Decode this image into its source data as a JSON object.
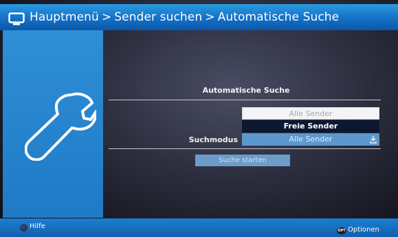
{
  "header": {
    "breadcrumb": [
      "Hauptmenü",
      "Sender suchen",
      "Automatische Suche"
    ],
    "separator": ">",
    "icon": "tv-icon"
  },
  "sidepanel": {
    "icon": "wrench-icon"
  },
  "main": {
    "heading": "Automatische Suche",
    "field_label": "Suchmodus",
    "dropdown": {
      "options": [
        "Alle Sender",
        "Freie Sender"
      ],
      "highlighted": "Freie Sender",
      "current_value": "Alle Sender",
      "icon": "download-arrow-icon"
    },
    "start_button": "Suche starten"
  },
  "footer": {
    "help_label": "Hilfe",
    "options_badge": "OPT",
    "options_label": "Optionen"
  },
  "colors": {
    "title_bar": "#1470c7",
    "side_panel": "#2f8ed6",
    "highlight": "#0c1830",
    "footer": "#135fae"
  }
}
